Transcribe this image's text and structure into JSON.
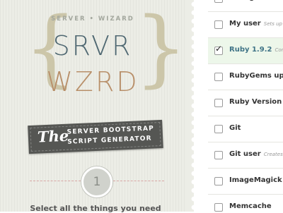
{
  "brand": {
    "eyebrow": "SERVER • WIZARD",
    "word1": "SRVR",
    "word2": "WZRD",
    "brace_left": "{",
    "brace_right": "}"
  },
  "banner": {
    "the": "The",
    "line1": "SERVER BOOTSTRAP",
    "line2": "SCRIPT GENERATOR"
  },
  "step": {
    "number": "1",
    "instruction": "Select all the things you need"
  },
  "items": [
    {
      "label": "Change host name",
      "sub": "",
      "checked": false
    },
    {
      "label": "My user",
      "sub": "Sets up a u",
      "checked": false
    },
    {
      "label": "Ruby 1.9.2",
      "sub": "Compile",
      "checked": true
    },
    {
      "label": "RubyGems update",
      "sub": "",
      "checked": false
    },
    {
      "label": "Ruby Version Man",
      "sub": "",
      "checked": false
    },
    {
      "label": "Git",
      "sub": "",
      "checked": false
    },
    {
      "label": "Git user",
      "sub": "Creates a",
      "checked": false
    },
    {
      "label": "ImageMagick",
      "sub": "",
      "checked": false
    },
    {
      "label": "Memcache",
      "sub": "",
      "checked": false
    }
  ],
  "check_glyph": "✓",
  "colors": {
    "panel_bg": "#ecede6",
    "word1": "#4f6872",
    "word2": "#b88f69",
    "brace": "#ccc6a9",
    "banner": "#555653",
    "selected_row": "#edf7ea",
    "selected_text": "#3f7386"
  }
}
